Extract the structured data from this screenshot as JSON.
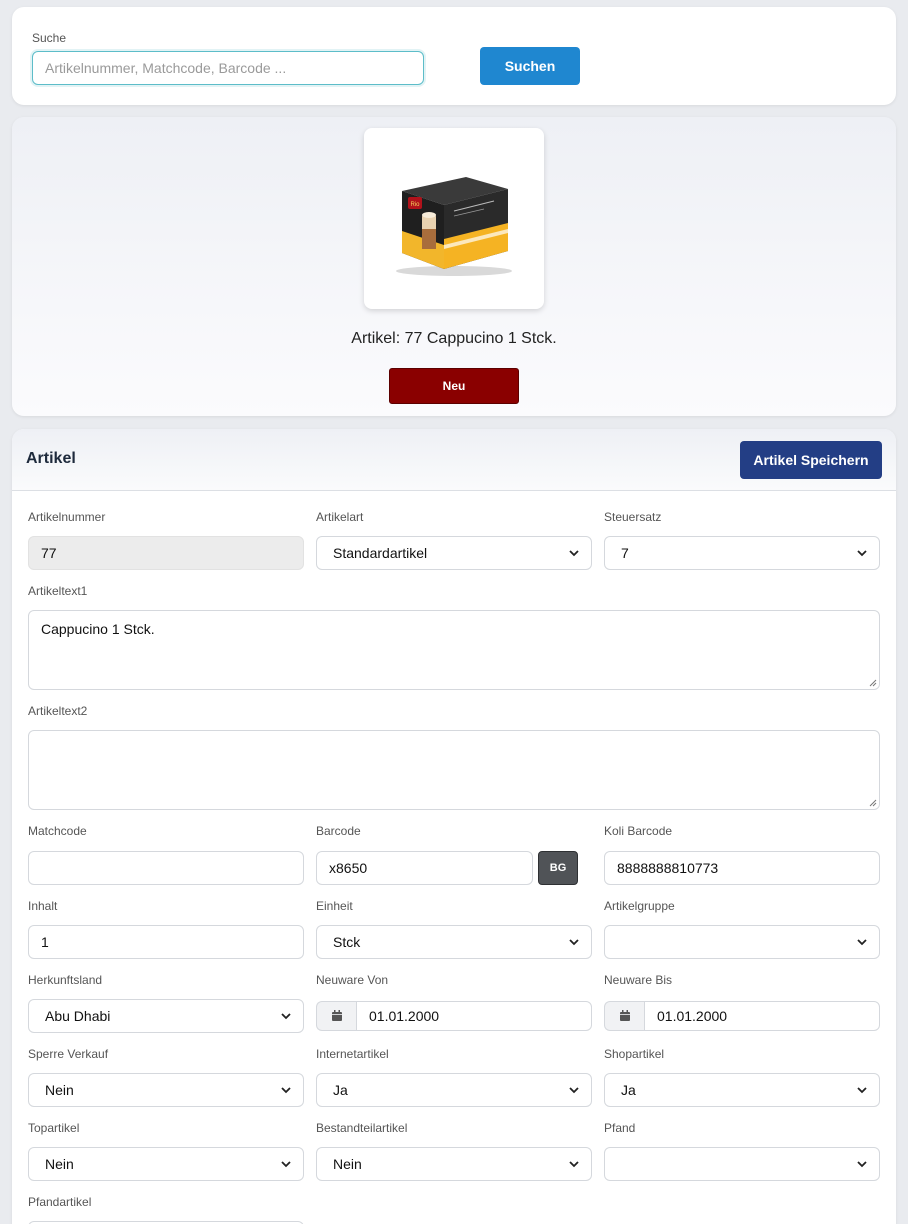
{
  "search": {
    "label": "Suche",
    "placeholder": "Artikelnummer, Matchcode, Barcode ...",
    "value": "",
    "button_label": "Suchen"
  },
  "product": {
    "image_icon": "coffee-capsule-box-image",
    "title": "Artikel: 77 Cappucino 1 Stck.",
    "new_button_label": "Neu",
    "new_button_color": "#8a0000"
  },
  "article": {
    "heading": "Artikel",
    "save_label": "Artikel Speichern",
    "save_color": "#233e85",
    "fields": {
      "artikelnummer": {
        "label": "Artikelnummer",
        "value": "77"
      },
      "artikelart": {
        "label": "Artikelart",
        "value": "Standardartikel"
      },
      "steuersatz": {
        "label": "Steuersatz",
        "value": "7"
      },
      "artikeltext1": {
        "label": "Artikeltext1",
        "value": "Cappucino 1 Stck."
      },
      "artikeltext2": {
        "label": "Artikeltext2",
        "value": ""
      },
      "matchcode": {
        "label": "Matchcode",
        "value": ""
      },
      "barcode": {
        "label": "Barcode",
        "value": "x8650",
        "button_label": "BG"
      },
      "koli_barcode": {
        "label": "Koli Barcode",
        "value": "8888888810773"
      },
      "inhalt": {
        "label": "Inhalt",
        "value": "1"
      },
      "einheit": {
        "label": "Einheit",
        "value": "Stck"
      },
      "artikelgruppe": {
        "label": "Artikelgruppe",
        "value": ""
      },
      "herkunftsland": {
        "label": "Herkunftsland",
        "value": "Abu Dhabi"
      },
      "neuware_von": {
        "label": "Neuware Von",
        "value": "01.01.2000"
      },
      "neuware_bis": {
        "label": "Neuware Bis",
        "value": "01.01.2000"
      },
      "sperre_verkauf": {
        "label": "Sperre Verkauf",
        "value": "Nein"
      },
      "internetartikel": {
        "label": "Internetartikel",
        "value": "Ja"
      },
      "shopartikel": {
        "label": "Shopartikel",
        "value": "Ja"
      },
      "topartikel": {
        "label": "Topartikel",
        "value": "Nein"
      },
      "bestandteilartikel": {
        "label": "Bestandteilartikel",
        "value": "Nein"
      },
      "pfand": {
        "label": "Pfand",
        "value": ""
      },
      "pfandartikel": {
        "label": "Pfandartikel",
        "value": ""
      }
    }
  }
}
